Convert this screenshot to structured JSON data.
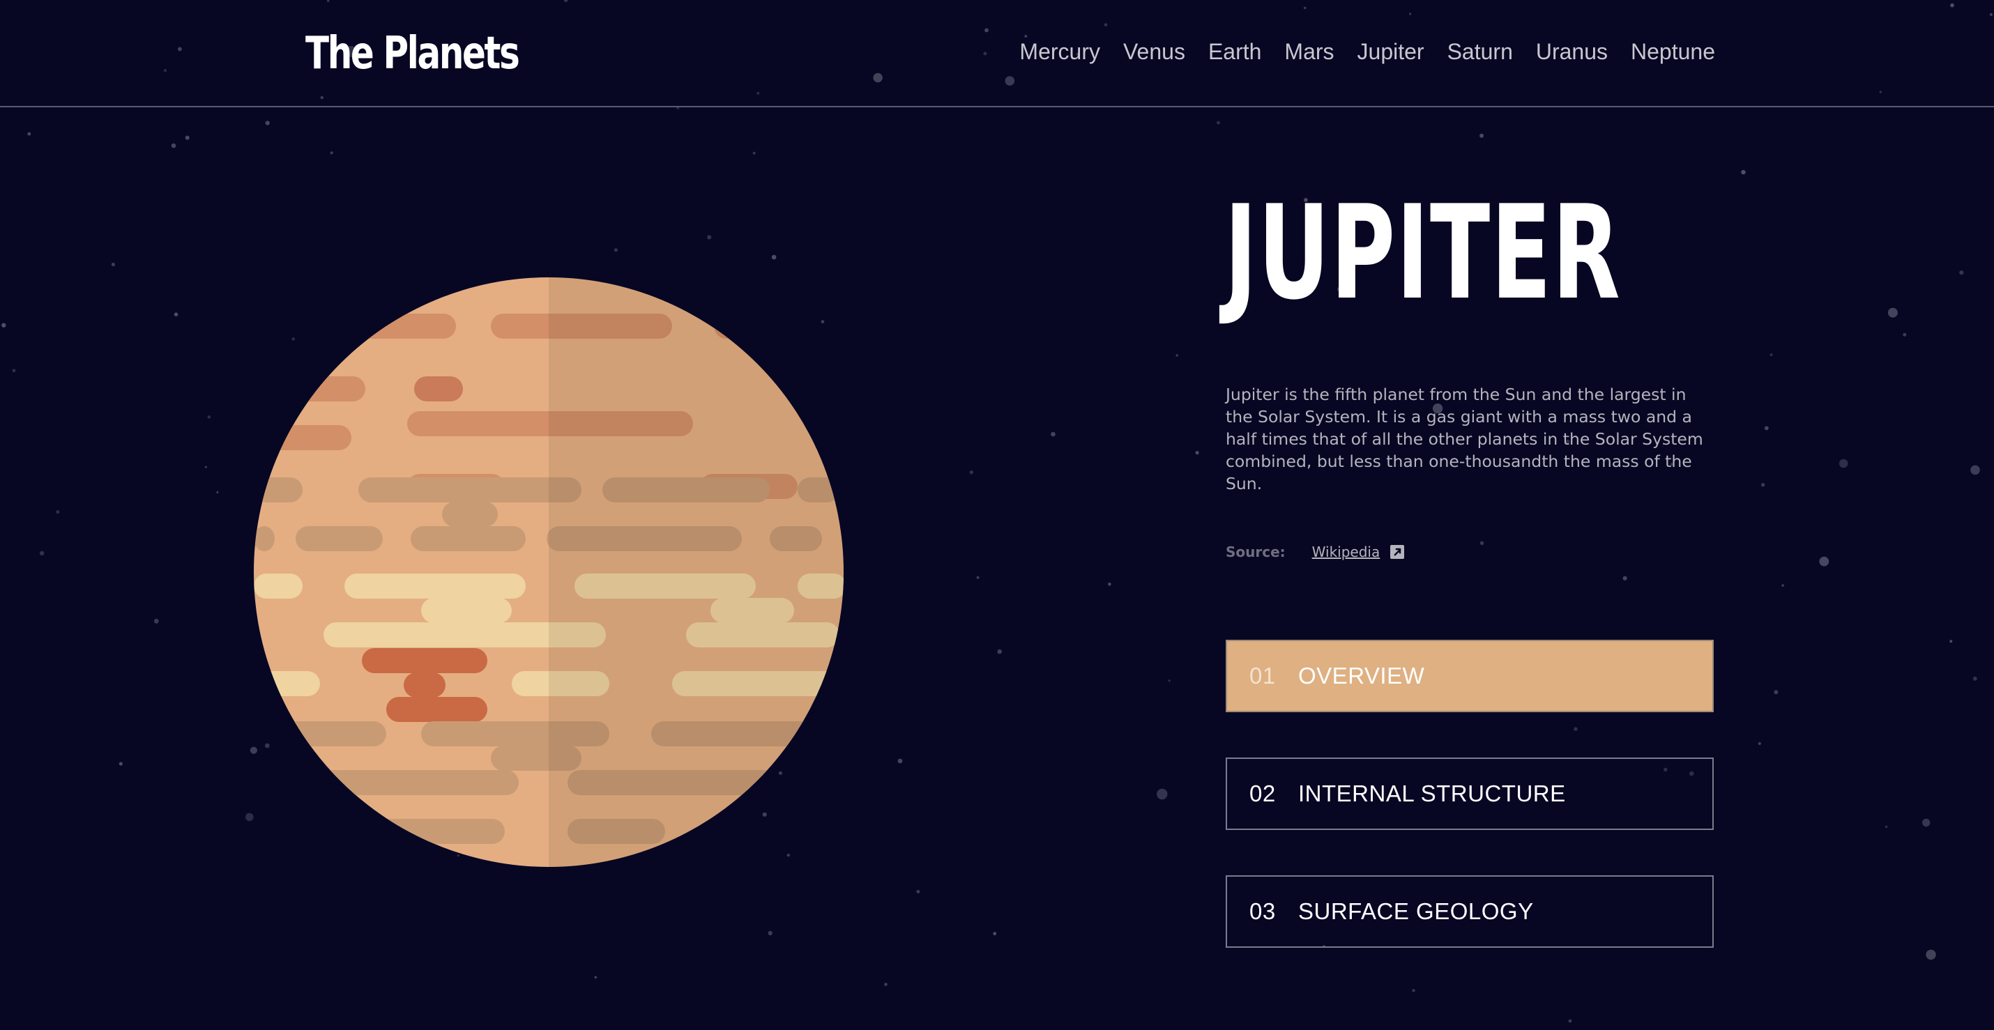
{
  "site": {
    "logo": "The Planets"
  },
  "nav": {
    "items": [
      "Mercury",
      "Venus",
      "Earth",
      "Mars",
      "Jupiter",
      "Saturn",
      "Uranus",
      "Neptune"
    ]
  },
  "planet": {
    "name": "JUPITER",
    "description": "Jupiter is the fifth planet from the Sun and the largest in the Solar System. It is a gas giant with a mass two and a half times that of all the other planets in the Solar System combined, but less than one-thousandth the mass of the Sun.",
    "source_label": "Source:",
    "source_link": "Wikipedia"
  },
  "tabs": [
    {
      "num": "01",
      "label": "OVERVIEW",
      "active": true
    },
    {
      "num": "02",
      "label": "INTERNAL STRUCTURE",
      "active": false
    },
    {
      "num": "03",
      "label": "SURFACE GEOLOGY",
      "active": false
    }
  ],
  "colors": {
    "background": "#070724",
    "accent_active_tab": "#DEB082",
    "planet_base": "#E4AE82"
  },
  "icons": {
    "external_link": "external-link-icon"
  }
}
